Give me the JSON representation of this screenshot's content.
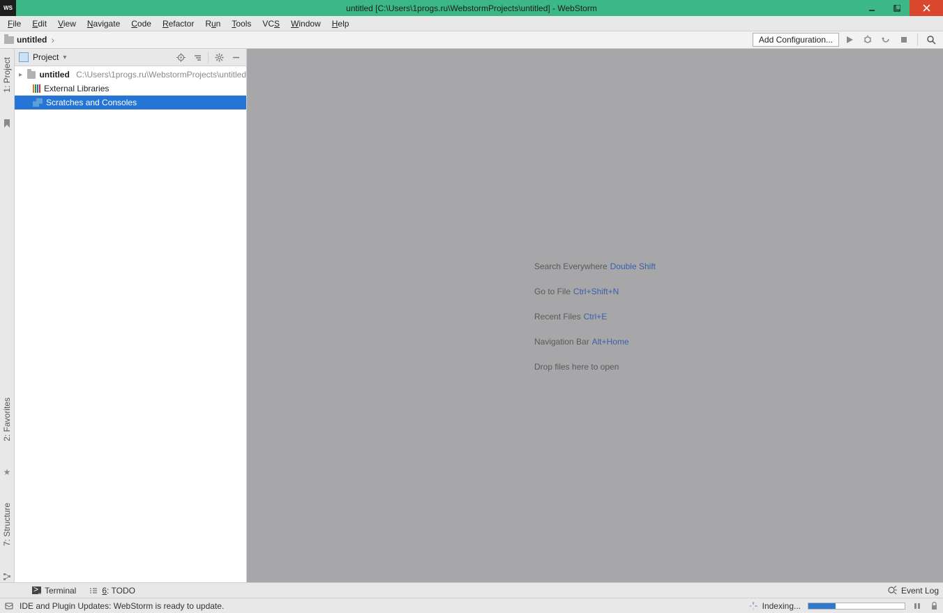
{
  "titlebar": {
    "app_icon": "WS",
    "title": "untitled [C:\\Users\\1progs.ru\\WebstormProjects\\untitled] - WebStorm"
  },
  "menubar": {
    "items": [
      "File",
      "Edit",
      "View",
      "Navigate",
      "Code",
      "Refactor",
      "Run",
      "Tools",
      "VCS",
      "Window",
      "Help"
    ]
  },
  "navbar": {
    "crumb_name": "untitled",
    "add_config": "Add Configuration..."
  },
  "left_gutter": {
    "project_tab": "1: Project",
    "favorites_tab": "2: Favorites",
    "structure_tab": "7: Structure"
  },
  "project_panel": {
    "header_label": "Project",
    "tree": {
      "root_name": "untitled",
      "root_path": "C:\\Users\\1progs.ru\\WebstormProjects\\untitled",
      "external_libs": "External Libraries",
      "scratches": "Scratches and Consoles"
    }
  },
  "editor_hints": [
    {
      "label": "Search Everywhere",
      "shortcut": "Double Shift"
    },
    {
      "label": "Go to File",
      "shortcut": "Ctrl+Shift+N"
    },
    {
      "label": "Recent Files",
      "shortcut": "Ctrl+E"
    },
    {
      "label": "Navigation Bar",
      "shortcut": "Alt+Home"
    },
    {
      "label": "Drop files here to open",
      "shortcut": ""
    }
  ],
  "bottom_tabs": {
    "terminal": "Terminal",
    "todo": "6: TODO",
    "event_log": "Event Log"
  },
  "statusbar": {
    "message": "IDE and Plugin Updates: WebStorm is ready to update.",
    "indexing": "Indexing..."
  }
}
